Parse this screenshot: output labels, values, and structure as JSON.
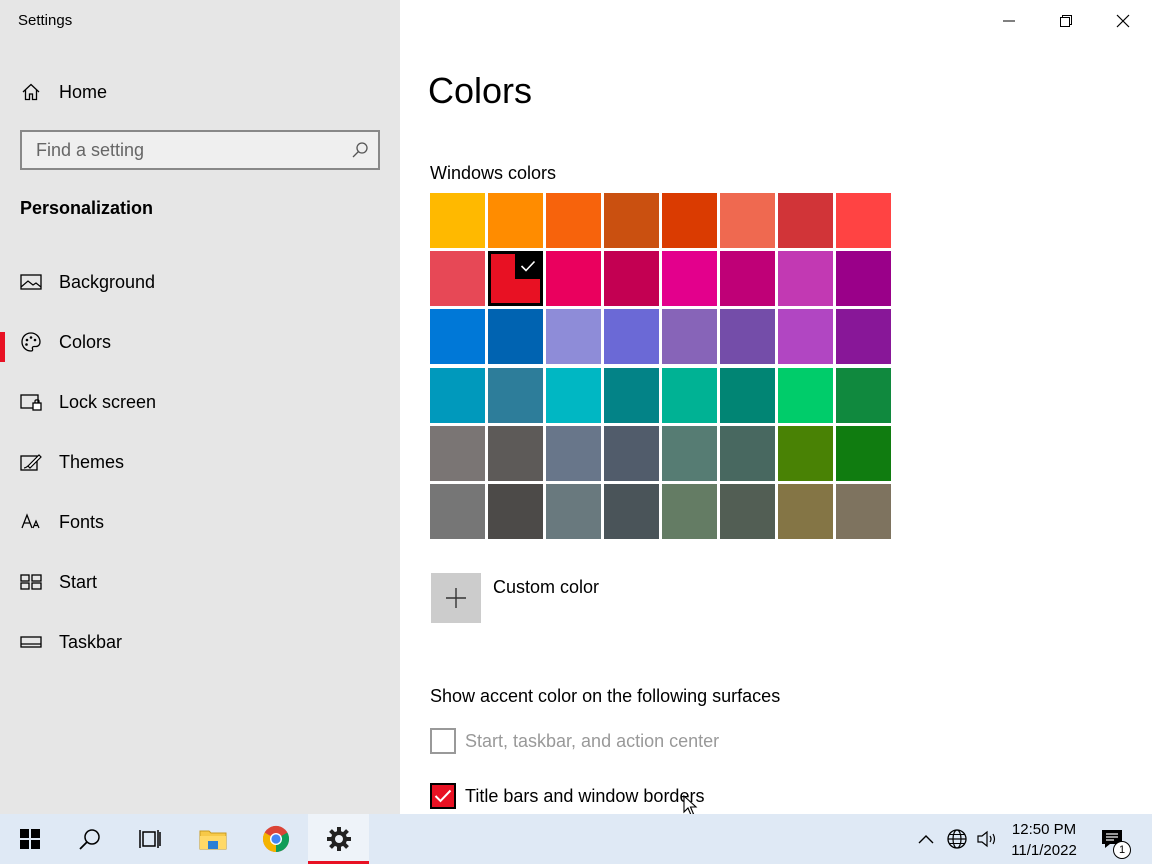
{
  "window": {
    "app_title": "Settings"
  },
  "sidebar": {
    "home_label": "Home",
    "search_placeholder": "Find a setting",
    "section_heading": "Personalization",
    "items": [
      {
        "label": "Background",
        "icon": "picture-icon"
      },
      {
        "label": "Colors",
        "icon": "palette-icon",
        "active": true
      },
      {
        "label": "Lock screen",
        "icon": "lock-screen-icon"
      },
      {
        "label": "Themes",
        "icon": "themes-icon"
      },
      {
        "label": "Fonts",
        "icon": "fonts-icon"
      },
      {
        "label": "Start",
        "icon": "start-icon"
      },
      {
        "label": "Taskbar",
        "icon": "taskbar-icon"
      }
    ]
  },
  "main": {
    "title": "Colors",
    "windows_colors_label": "Windows colors",
    "selected_color": "#e81123",
    "swatches": [
      [
        "#ffb900",
        "#ff8c00",
        "#f7630c",
        "#ca5010",
        "#da3b01",
        "#ef6950",
        "#d13438",
        "#ff4343"
      ],
      [
        "#e74856",
        "#e81123",
        "#ea005e",
        "#c30052",
        "#e3008c",
        "#bf0077",
        "#c239b3",
        "#9a0089"
      ],
      [
        "#0078d7",
        "#0063b1",
        "#8e8cd8",
        "#6b69d6",
        "#8764b8",
        "#744da9",
        "#b146c2",
        "#881798"
      ],
      [
        "#0099bc",
        "#2d7d9a",
        "#00b7c3",
        "#038387",
        "#00b294",
        "#018574",
        "#00cc6a",
        "#10893e"
      ],
      [
        "#7a7574",
        "#5d5a58",
        "#68768a",
        "#515c6b",
        "#567c73",
        "#486860",
        "#498205",
        "#107c10"
      ],
      [
        "#767676",
        "#4c4a48",
        "#69797e",
        "#4a5459",
        "#647c64",
        "#525e54",
        "#847545",
        "#7e735f"
      ]
    ],
    "custom_color_label": "Custom color",
    "surfaces_label": "Show accent color on the following surfaces",
    "checkboxes": [
      {
        "label": "Start, taskbar, and action center",
        "checked": false,
        "disabled": true
      },
      {
        "label": "Title bars and window borders",
        "checked": true,
        "disabled": false
      }
    ]
  },
  "taskbar": {
    "time": "12:50 PM",
    "date": "11/1/2022",
    "notification_count": "1",
    "apps": [
      "start-icon",
      "search-icon",
      "task-view-icon",
      "file-explorer-icon",
      "chrome-icon",
      "settings-icon"
    ]
  }
}
